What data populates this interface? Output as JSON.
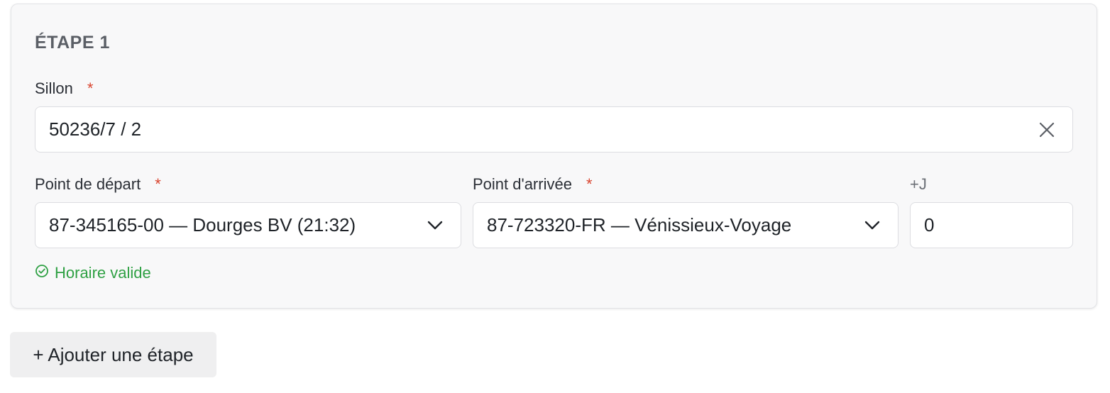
{
  "step": {
    "title": "ÉTAPE 1"
  },
  "sillon": {
    "label": "Sillon",
    "required_mark": "*",
    "value": "50236/7 / 2",
    "clear_icon": "close-icon"
  },
  "depart": {
    "label": "Point de départ",
    "required_mark": "*",
    "value": "87-345165-00 — Dourges BV (21:32)",
    "icon": "chevron-down-icon"
  },
  "arrivee": {
    "label": "Point d'arrivée",
    "required_mark": "*",
    "value": "87-723320-FR — Vénissieux-Voyage",
    "icon": "chevron-down-icon"
  },
  "day_offset": {
    "label": "+J",
    "value": "0"
  },
  "status": {
    "text": "Horaire valide",
    "icon": "check-circle-icon",
    "color": "#2ea043"
  },
  "actions": {
    "add_step_label": "+ Ajouter une étape"
  },
  "colors": {
    "required": "#d9442e",
    "card_bg": "#f8f8f9"
  }
}
